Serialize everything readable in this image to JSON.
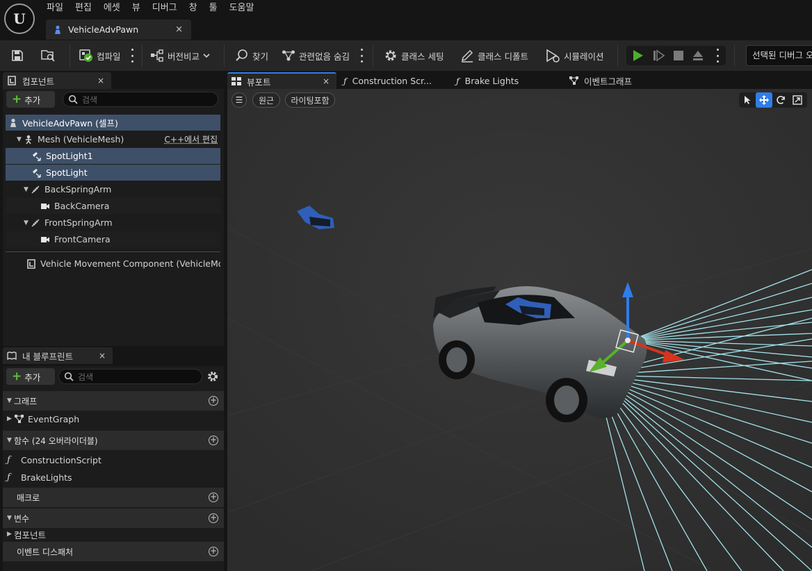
{
  "menu": [
    "파일",
    "편집",
    "에셋",
    "뷰",
    "디버그",
    "창",
    "툴",
    "도움말"
  ],
  "logo_text": "U",
  "document_tab": {
    "title": "VehicleAdvPawn",
    "close": "×"
  },
  "toolbar": {
    "compile": "컴파일",
    "diff": "버전비교",
    "find": "찾기",
    "hide_unrelated": "관련없음 숨김",
    "class_settings": "클래스 세팅",
    "class_defaults": "클래스 디폴트",
    "simulation": "시뮬레이션",
    "debug_select": "선택된 디버그 오브젝트 없음"
  },
  "components_panel": {
    "tab": "컴포넌트",
    "add": "추가",
    "search_placeholder": "검색",
    "root": "VehicleAdvPawn (셀프)",
    "mesh": "Mesh (VehicleMesh)",
    "edit_in_cpp": "C++에서 편집",
    "items": [
      "SpotLight1",
      "SpotLight",
      "BackSpringArm",
      "BackCamera",
      "FrontSpringArm",
      "FrontCamera"
    ],
    "movement": "Vehicle Movement Component (VehicleMovementComp)"
  },
  "blueprint_panel": {
    "tab": "내 블루프린트",
    "add": "추가",
    "search_placeholder": "검색",
    "graphs": "그래프",
    "event_graph": "EventGraph",
    "functions": "함수 (24 오버라이더블)",
    "construction_script": "ConstructionScript",
    "brake_lights": "BrakeLights",
    "macros": "매크로",
    "variables": "변수",
    "components": "컴포넌트",
    "event_dispatchers": "이벤트 디스패처"
  },
  "editor_tabs": {
    "viewport": "뷰포트",
    "construction": "Construction Scr...",
    "brake": "Brake Lights",
    "event_graph": "이벤트그래프"
  },
  "viewport": {
    "menu": "☰",
    "perspective": "원근",
    "lit": "라이팅포함"
  },
  "colors": {
    "play": "#4caf2a",
    "selection": "#3e5068",
    "gizmo_x": "#d6341c",
    "gizmo_y": "#58b22a",
    "gizmo_z": "#2f7de8",
    "light_rays": "#a8ecf4"
  }
}
